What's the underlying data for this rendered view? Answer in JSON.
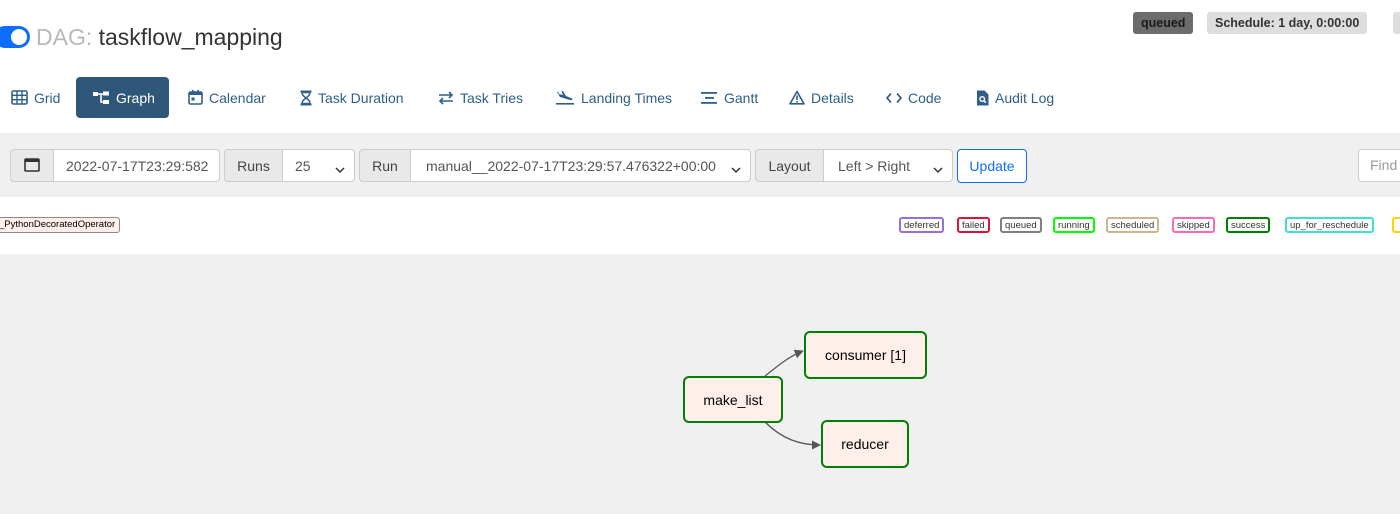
{
  "header": {
    "dag_prefix": "DAG: ",
    "dag_id": "taskflow_mapping",
    "state_badge": "queued",
    "schedule_badge": "Schedule: 1 day, 0:00:00",
    "paused_toggle_on": true
  },
  "nav": {
    "tabs": [
      {
        "label": "Grid",
        "icon": "grid-icon"
      },
      {
        "label": "Graph",
        "icon": "graph-icon",
        "active": true
      },
      {
        "label": "Calendar",
        "icon": "calendar-icon"
      },
      {
        "label": "Task Duration",
        "icon": "hourglass-icon"
      },
      {
        "label": "Task Tries",
        "icon": "arrows-exchange-icon"
      },
      {
        "label": "Landing Times",
        "icon": "plane-landing-icon"
      },
      {
        "label": "Gantt",
        "icon": "gantt-icon"
      },
      {
        "label": "Details",
        "icon": "warning-triangle-icon"
      },
      {
        "label": "Code",
        "icon": "code-icon"
      },
      {
        "label": "Audit Log",
        "icon": "file-search-icon"
      }
    ]
  },
  "controls": {
    "base_date": "2022-07-17T23:29:582",
    "runs_label": "Runs",
    "runs_value": "25",
    "run_label": "Run",
    "run_value": "manual__2022-07-17T23:29:57.476322+00:00",
    "layout_label": "Layout",
    "layout_value": "Left > Right",
    "update_label": "Update",
    "find_placeholder": "Find"
  },
  "legend": {
    "operator": "_PythonDecoratedOperator",
    "states": [
      {
        "label": "deferred",
        "color": "#9370db"
      },
      {
        "label": "failed",
        "color": "#dc143c"
      },
      {
        "label": "queued",
        "color": "#808080"
      },
      {
        "label": "running",
        "color": "#00ff00"
      },
      {
        "label": "scheduled",
        "color": "#d2b48c"
      },
      {
        "label": "skipped",
        "color": "#ff69b4"
      },
      {
        "label": "success",
        "color": "#008000"
      },
      {
        "label": "up_for_reschedule",
        "color": "#40e0d0"
      },
      {
        "label": "",
        "color": "#ffd700"
      }
    ]
  },
  "graph": {
    "nodes": [
      {
        "id": "make_list",
        "label": "make_list",
        "state": "success"
      },
      {
        "id": "consumer",
        "label": "consumer [1]",
        "state": "success"
      },
      {
        "id": "reducer",
        "label": "reducer",
        "state": "success"
      }
    ],
    "edges": [
      {
        "from": "make_list",
        "to": "consumer"
      },
      {
        "from": "make_list",
        "to": "reducer"
      }
    ]
  },
  "colors": {
    "accent": "#0d6efd",
    "nav_active": "#2e5779",
    "node_fill": "#ffefeb",
    "success_border": "#008000"
  }
}
